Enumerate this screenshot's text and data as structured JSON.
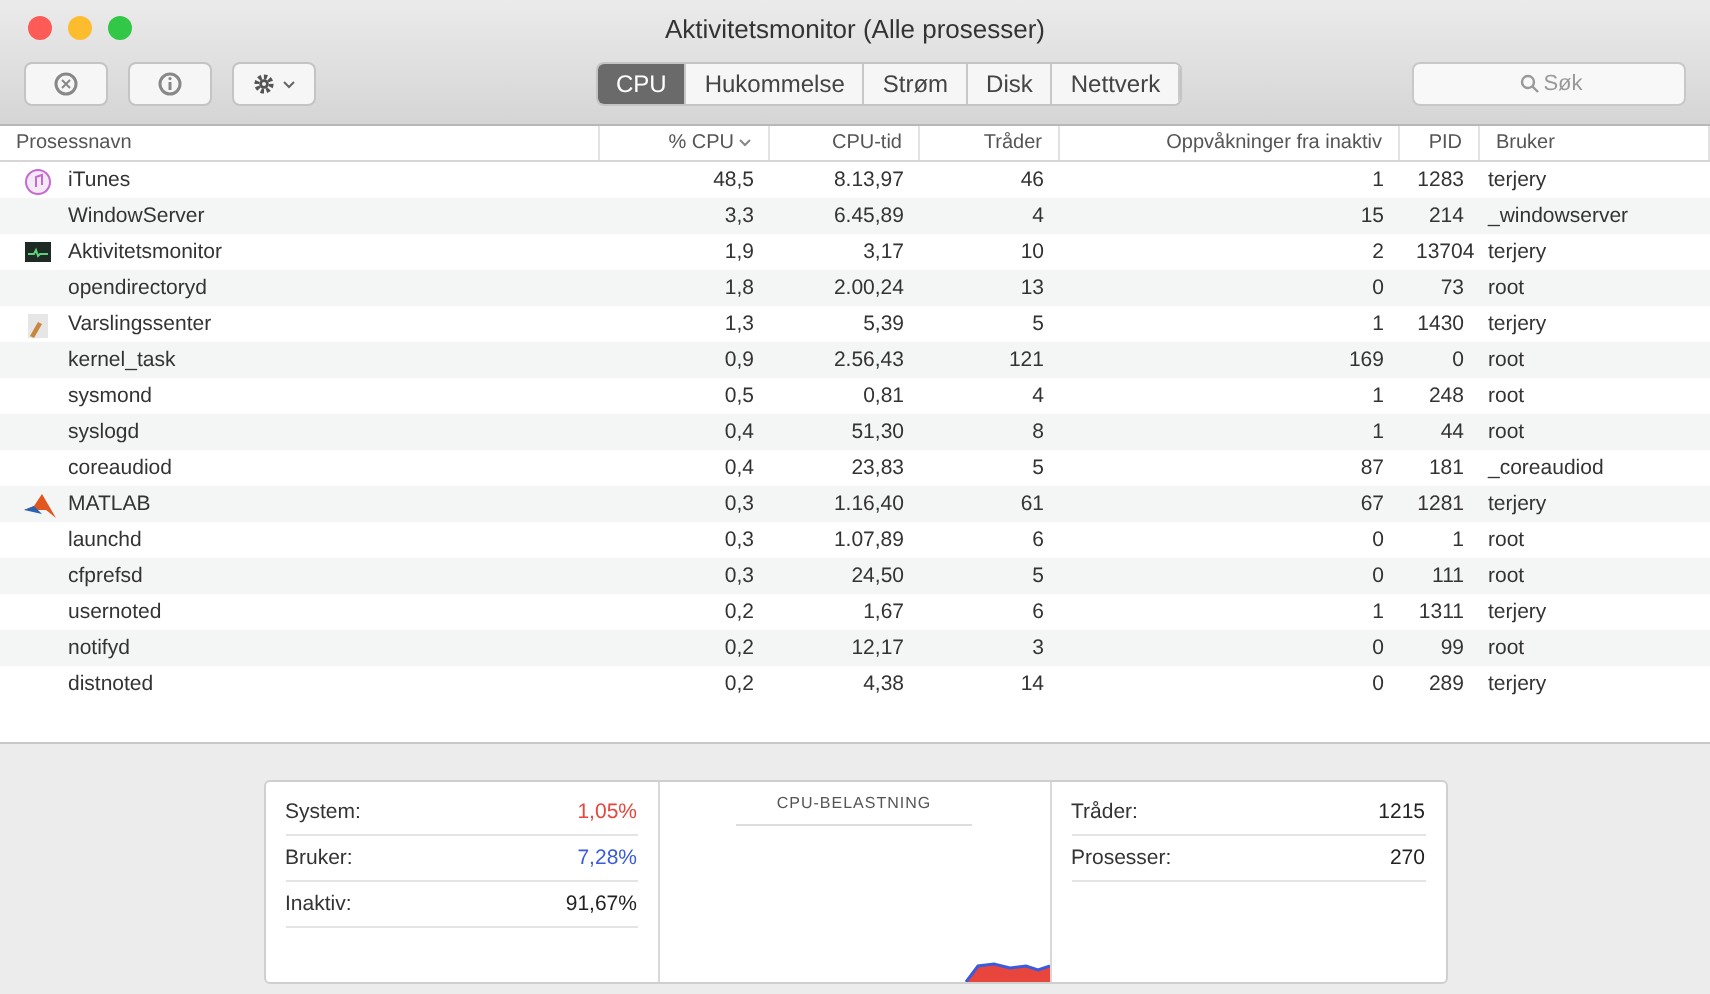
{
  "window": {
    "title": "Aktivitetsmonitor (Alle prosesser)"
  },
  "toolbar": {
    "buttons": [
      {
        "kind": "stop"
      },
      {
        "kind": "info"
      },
      {
        "kind": "gear"
      }
    ]
  },
  "tabs": [
    {
      "label": "CPU",
      "selected": true
    },
    {
      "label": "Hukommelse",
      "selected": false
    },
    {
      "label": "Strøm",
      "selected": false
    },
    {
      "label": "Disk",
      "selected": false
    },
    {
      "label": "Nettverk",
      "selected": false
    }
  ],
  "search": {
    "placeholder": "Søk"
  },
  "table": {
    "columns": [
      {
        "label": "Prosessnavn",
        "sorted": false
      },
      {
        "label": "% CPU",
        "sorted": true
      },
      {
        "label": "CPU-tid",
        "sorted": false
      },
      {
        "label": "Tråder",
        "sorted": false
      },
      {
        "label": "Oppvåkninger fra inaktiv",
        "sorted": false
      },
      {
        "label": "PID",
        "sorted": false
      },
      {
        "label": "Bruker",
        "sorted": false
      }
    ],
    "rows": [
      {
        "kind": "music",
        "cells": [
          "iTunes",
          "48,5",
          "8.13,97",
          "46",
          "1",
          "1283",
          "terjery"
        ]
      },
      {
        "kind": "none",
        "cells": [
          "WindowServer",
          "3,3",
          "6.45,89",
          "4",
          "15",
          "214",
          "_windowserver"
        ]
      },
      {
        "kind": "monitor",
        "cells": [
          "Aktivitetsmonitor",
          "1,9",
          "3,17",
          "10",
          "2",
          "13704",
          "terjery"
        ]
      },
      {
        "kind": "none",
        "cells": [
          "opendirectoryd",
          "1,8",
          "2.00,24",
          "13",
          "0",
          "73",
          "root"
        ]
      },
      {
        "kind": "notes",
        "cells": [
          "Varslingssenter",
          "1,3",
          "5,39",
          "5",
          "1",
          "1430",
          "terjery"
        ]
      },
      {
        "kind": "none",
        "cells": [
          "kernel_task",
          "0,9",
          "2.56,43",
          "121",
          "169",
          "0",
          "root"
        ]
      },
      {
        "kind": "none",
        "cells": [
          "sysmond",
          "0,5",
          "0,81",
          "4",
          "1",
          "248",
          "root"
        ]
      },
      {
        "kind": "none",
        "cells": [
          "syslogd",
          "0,4",
          "51,30",
          "8",
          "1",
          "44",
          "root"
        ]
      },
      {
        "kind": "none",
        "cells": [
          "coreaudiod",
          "0,4",
          "23,83",
          "5",
          "87",
          "181",
          "_coreaudiod"
        ]
      },
      {
        "kind": "peak",
        "cells": [
          "MATLAB",
          "0,3",
          "1.16,40",
          "61",
          "67",
          "1281",
          "terjery"
        ]
      },
      {
        "kind": "none",
        "cells": [
          "launchd",
          "0,3",
          "1.07,89",
          "6",
          "0",
          "1",
          "root"
        ]
      },
      {
        "kind": "none",
        "cells": [
          "cfprefsd",
          "0,3",
          "24,50",
          "5",
          "0",
          "111",
          "root"
        ]
      },
      {
        "kind": "none",
        "cells": [
          "usernoted",
          "0,2",
          "1,67",
          "6",
          "1",
          "1311",
          "terjery"
        ]
      },
      {
        "kind": "none",
        "cells": [
          "notifyd",
          "0,2",
          "12,17",
          "3",
          "0",
          "99",
          "root"
        ]
      },
      {
        "kind": "none",
        "cells": [
          "distnoted",
          "0,2",
          "4,38",
          "14",
          "0",
          "289",
          "terjery"
        ]
      }
    ]
  },
  "summary": {
    "stats": [
      {
        "label": "System:",
        "value": "1,05%",
        "color": "#e8453c"
      },
      {
        "label": "Bruker:",
        "value": "7,28%",
        "color": "#3b5bdb"
      },
      {
        "label": "Inaktiv:",
        "value": "91,67%",
        "color": "#222222"
      }
    ],
    "chart_title": "CPU-BELASTNING",
    "counts": [
      {
        "label": "Tråder:",
        "value": "1215"
      },
      {
        "label": "Prosesser:",
        "value": "270"
      }
    ]
  }
}
